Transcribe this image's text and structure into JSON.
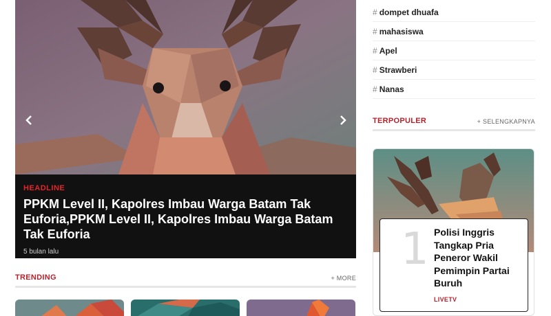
{
  "hero": {
    "tag": "HEADLINE",
    "title": "PPKM Level II, Kapolres Imbau Warga Batam Tak Euforia,PPKM Level II, Kapolres Imbau Warga Batam Tak Euforia",
    "time": "5 bulan lalu",
    "prev_icon": "chevron-left-icon",
    "next_icon": "chevron-right-icon"
  },
  "trending": {
    "title": "TRENDING",
    "more": "+ MORE"
  },
  "tags": [
    {
      "hash": "#",
      "label": "dompet dhuafa"
    },
    {
      "hash": "#",
      "label": "mahasiswa"
    },
    {
      "hash": "#",
      "label": "Apel"
    },
    {
      "hash": "#",
      "label": "Strawberi"
    },
    {
      "hash": "#",
      "label": "Nanas"
    }
  ],
  "popular": {
    "title": "TERPOPULER",
    "more": "+ SELENGKAPNYA",
    "items": [
      {
        "rank": "1",
        "title": "Polisi Inggris Tangkap Pria Peneror Wakil Pemimpin Partai Buruh",
        "category": "LIVETV"
      }
    ]
  },
  "colors": {
    "accent": "#b8202a",
    "headline_tag": "#e5252a",
    "caption_bg": "#111111"
  }
}
